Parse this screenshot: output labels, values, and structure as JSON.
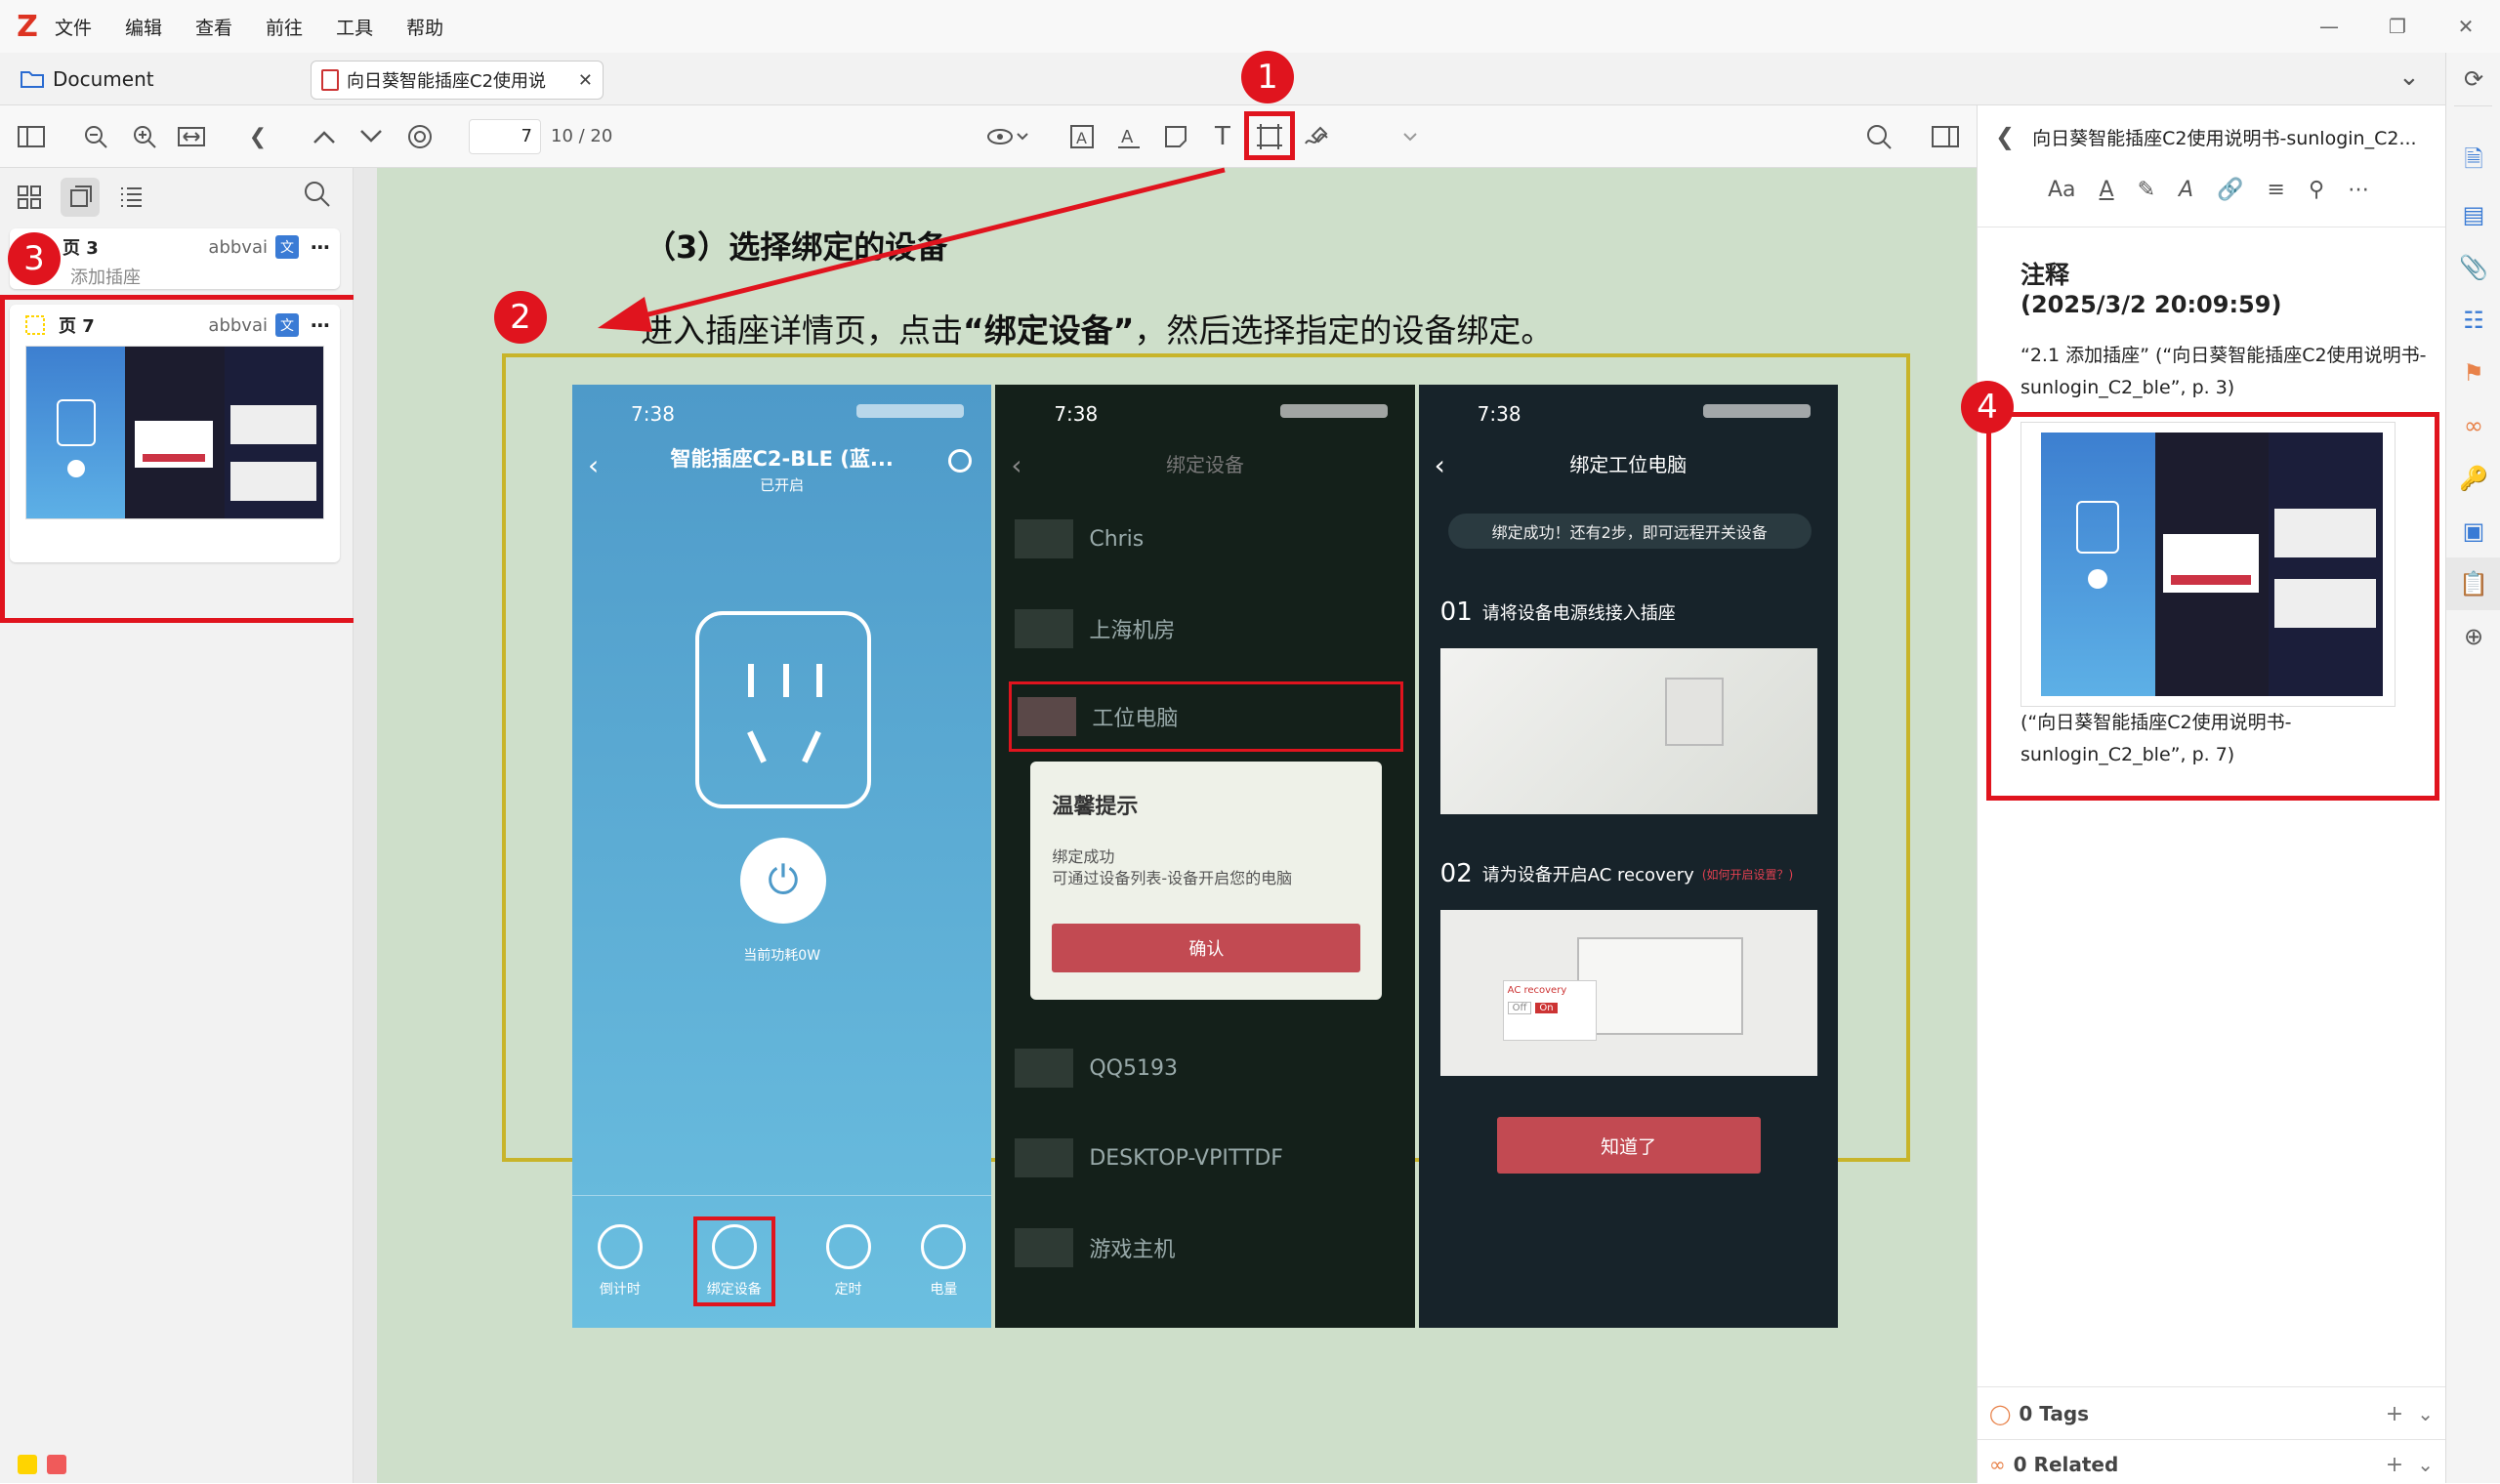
{
  "menubar": {
    "logo": "Z",
    "items": [
      "文件",
      "编辑",
      "查看",
      "前往",
      "工具",
      "帮助"
    ]
  },
  "tabs": {
    "library": "Document",
    "document": "向日葵智能插座C2使用说"
  },
  "toolbar": {
    "page_input": "7",
    "page_count": "10 / 20"
  },
  "sidebar": {
    "thumbs": [
      {
        "page": "页 3",
        "author": "abbvai",
        "text": "添加插座"
      },
      {
        "page": "页 7",
        "author": "abbvai"
      }
    ]
  },
  "callouts": [
    "1",
    "2",
    "3",
    "4"
  ],
  "pdf": {
    "heading": "（3）选择绑定的设备",
    "body_pre": "进入插座详情页，点击",
    "body_bold": "“绑定设备”",
    "body_post": "，然后选择指定的设备绑定。",
    "phone1": {
      "time": "7:38",
      "title": "智能插座C2-BLE (蓝...",
      "sub": "已开启",
      "power": "当前功耗0W",
      "tabs": [
        "倒计时",
        "绑定设备",
        "定时",
        "电量"
      ]
    },
    "phone2": {
      "time": "7:38",
      "title": "绑定设备",
      "devices": [
        "Chris",
        "上海机房",
        "工位电脑",
        "QQ5193",
        "DESKTOP-VPITTDF",
        "游戏主机"
      ],
      "dialog_title": "温馨提示",
      "dialog_line1": "绑定成功",
      "dialog_line2": "可通过设备列表-设备开启您的电脑",
      "dialog_btn": "确认"
    },
    "phone3": {
      "time": "7:38",
      "title": "绑定工位电脑",
      "banner": "绑定成功！还有2步，即可远程开关设备",
      "step1_num": "01",
      "step1": "请将设备电源线接入插座",
      "step2_num": "02",
      "step2": "请为设备开启AC recovery",
      "step2_link": "(如何开启设置？)",
      "ac_label": "AC recovery",
      "off": "Off",
      "on": "On",
      "btn": "知道了"
    }
  },
  "rpane": {
    "title": "向日葵智能插座C2使用说明书-sunlogin_C2...",
    "note_title": "注释",
    "note_date": "(2025/3/2 20:09:59)",
    "quote": "“2.1 添加插座” (“向日葵智能插座C2使用说明书-sunlogin_C2_ble”, p. 3)",
    "citation": "(“向日葵智能插座C2使用说明书-sunlogin_C2_ble”, p. 7)",
    "tags": "0 Tags",
    "related": "0 Related"
  },
  "colors": {
    "callout_red": "#e0141e",
    "highlight_yellow": "#ffd400",
    "swatch_red": "#f05a5a"
  }
}
